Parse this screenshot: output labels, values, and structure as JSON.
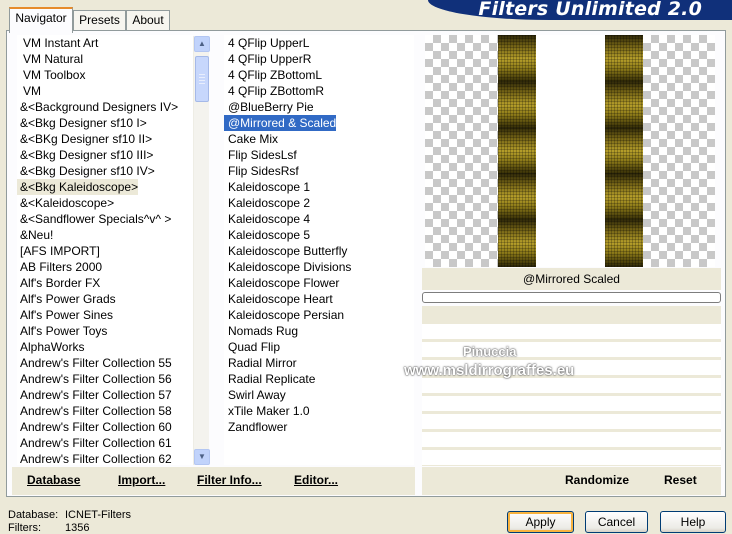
{
  "app_title": "Filters Unlimited 2.0",
  "tabs": [
    "Navigator",
    "Presets",
    "About"
  ],
  "categories": [
    "VM Instant Art",
    "VM Natural",
    "VM Toolbox",
    "VM",
    "&<Background Designers IV>",
    "&<Bkg Designer sf10 I>",
    "&<BKg Designer sf10 II>",
    "&<Bkg Designer sf10 III>",
    "&<Bkg Designer sf10 IV>",
    "&<Bkg Kaleidoscope>",
    "&<Kaleidoscope>",
    "&<Sandflower Specials^v^ >",
    "&Neu!",
    "[AFS IMPORT]",
    "AB Filters 2000",
    "Alf's Border FX",
    "Alf's Power Grads",
    "Alf's Power Sines",
    "Alf's Power Toys",
    "AlphaWorks",
    "Andrew's Filter Collection 55",
    "Andrew's Filter Collection 56",
    "Andrew's Filter Collection 57",
    "Andrew's Filter Collection 58",
    "Andrew's Filter Collection 60",
    "Andrew's Filter Collection 61",
    "Andrew's Filter Collection 62"
  ],
  "selected_category": "&<Bkg Kaleidoscope>",
  "filters": [
    "4 QFlip UpperL",
    "4 QFlip UpperR",
    "4 QFlip ZBottomL",
    "4 QFlip ZBottomR",
    "@BlueBerry Pie",
    "@Mirrored & Scaled",
    "Cake Mix",
    "Flip SidesLsf",
    "Flip SidesRsf",
    "Kaleidoscope 1",
    "Kaleidoscope 2",
    "Kaleidoscope 4",
    "Kaleidoscope 5",
    "Kaleidoscope Butterfly",
    "Kaleidoscope Divisions",
    "Kaleidoscope Flower",
    "Kaleidoscope Heart",
    "Kaleidoscope Persian",
    "Nomads Rug",
    "Quad Flip",
    "Radial Mirror",
    "Radial Replicate",
    "Swirl Away",
    "xTile Maker 1.0",
    "Zandflower"
  ],
  "selected_filter": "@Mirrored & Scaled",
  "preview_caption": "@Mirrored  Scaled",
  "progress": 0,
  "buttons": {
    "database": "Database",
    "import": "Import...",
    "filter_info": "Filter Info...",
    "editor": "Editor...",
    "randomize": "Randomize",
    "reset": "Reset",
    "apply": "Apply",
    "cancel": "Cancel",
    "help": "Help"
  },
  "status": {
    "database_label": "Database:",
    "database_value": "ICNET-Filters",
    "filters_label": "Filters:",
    "filters_value": "1356"
  },
  "watermark": {
    "line1": "Pinuccia",
    "line2": "www.msldirrograffes.eu"
  },
  "colors": {
    "banner": "#10307a",
    "selection": "#316ac5",
    "window_bg": "#ece9d8"
  }
}
